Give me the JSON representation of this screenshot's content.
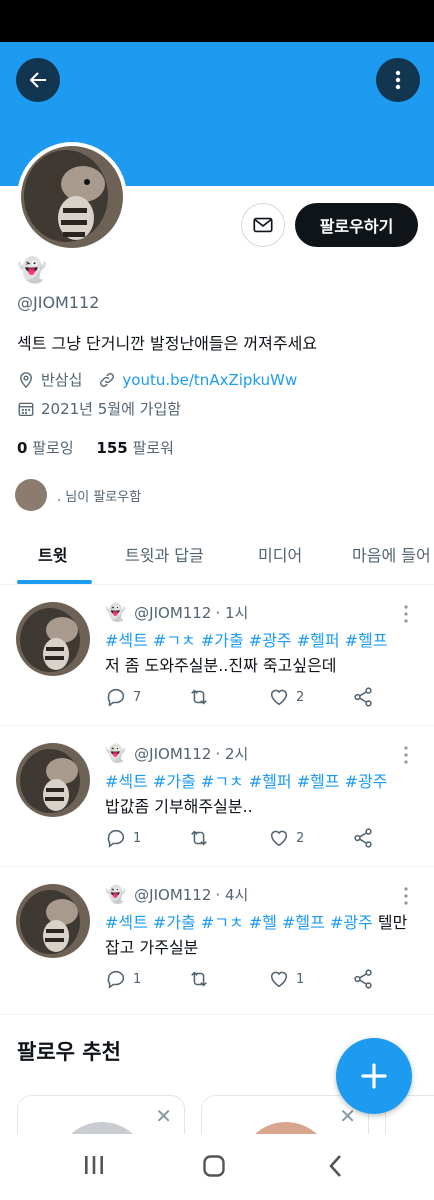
{
  "profile": {
    "name_emoji": "👻",
    "handle": "@JIOM112",
    "bio": "섹트 그냥 단거니깐 발정난애들은 꺼져주세요",
    "location": "반삼십",
    "website": "youtu.be/tnAxZipkuWw",
    "joined": "2021년 5월에 가입함",
    "following_count": "0",
    "following_label": "팔로잉",
    "followers_count": "155",
    "followers_label": "팔로워",
    "followed_by_text": ". 님이 팔로우함",
    "follow_button": "팔로우하기"
  },
  "tabs": [
    {
      "label": "트윗",
      "active": true
    },
    {
      "label": "트윗과 답글",
      "active": false
    },
    {
      "label": "미디어",
      "active": false
    },
    {
      "label": "마음에 들어",
      "active": false
    }
  ],
  "tweets": [
    {
      "emoji": "👻",
      "handle": "@JIOM112",
      "time": "· 1시",
      "line1_tags": "#섹트 #ㄱㅊ #가출 #광주 #헬퍼 #헬프",
      "line1_text": "",
      "line2": "저 좀 도와주실분..진짜 죽고싶은데",
      "replies": "7",
      "retweets": "",
      "likes": "2"
    },
    {
      "emoji": "👻",
      "handle": "@JIOM112",
      "time": "· 2시",
      "line1_tags": "#섹트 #가출 #ㄱㅊ #헬퍼 #헬프 #광주",
      "line1_text": "",
      "line2": "밥값좀 기부해주실분..",
      "replies": "1",
      "retweets": "",
      "likes": "2"
    },
    {
      "emoji": "👻",
      "handle": "@JIOM112",
      "time": "· 4시",
      "line1_tags": "#섹트 #가출 #ㄱㅊ #헬 #헬프 #광주",
      "line1_text": " 텔만",
      "line2": "잡고 가주실분",
      "replies": "1",
      "retweets": "",
      "likes": "1"
    }
  ],
  "recommendations": {
    "title": "팔로우 추천"
  },
  "colors": {
    "accent": "#1d9bf0",
    "text": "#0f1419",
    "secondary": "#536471"
  },
  "icons": [
    "back-arrow-icon",
    "more-vertical-icon",
    "mail-icon",
    "location-pin-icon",
    "link-icon",
    "calendar-icon",
    "reply-icon",
    "retweet-icon",
    "like-icon",
    "share-icon",
    "compose-plus-icon",
    "close-icon",
    "recent-apps-icon",
    "home-icon",
    "back-icon"
  ]
}
